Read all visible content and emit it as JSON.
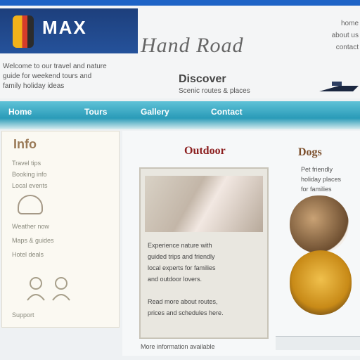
{
  "header": {
    "logo_text": "MAX",
    "title": "Hand Road",
    "top_links": [
      "home",
      "about us",
      "contact"
    ],
    "intro": [
      "Welcome to our travel and nature",
      "guide for weekend tours and",
      "family holiday ideas"
    ],
    "tagline": "Discover",
    "tagline_sub": "Scenic routes & places"
  },
  "nav": {
    "items": [
      "Home",
      "Tours",
      "Gallery",
      "Contact"
    ]
  },
  "sidebar": {
    "heading": "Info",
    "lines": [
      "Travel tips",
      "Booking info",
      "Local events",
      "Weather now",
      "Maps & guides",
      "Hotel deals",
      "Support"
    ]
  },
  "main": {
    "card_title": "Outdoor",
    "right_title": "Dogs",
    "card_lines": [
      "Experience nature with",
      "guided trips and friendly",
      "local experts for families",
      "and outdoor lovers.",
      "Read more about routes,",
      "prices and schedules here."
    ],
    "card_foot": "More information available",
    "right_lines": [
      "Pet friendly",
      "holiday places",
      "for families"
    ]
  }
}
